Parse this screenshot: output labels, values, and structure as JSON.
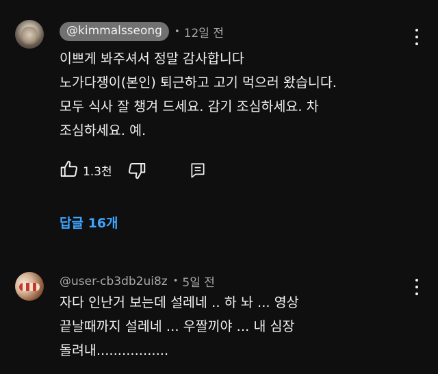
{
  "comments": [
    {
      "author": "@kimmalsseong",
      "separator": "•",
      "time": "12일 전",
      "lines": [
        "이쁘게 봐주셔서 정말 감사합니다",
        "노가다쟁이(본인) 퇴근하고 고기 먹으러 왔습니다.",
        "모두 식사 잘 챙겨 드세요. 감기 조심하세요. 차",
        "조심하세요. 예."
      ],
      "like_count": "1.3천",
      "replies_label": "답글 16개"
    },
    {
      "author": "@user-cb3db2ui8z",
      "separator": "•",
      "time": "5일 전",
      "lines": [
        "자다 인난거 보는데 설레네 .. 하 놔 ... 영상",
        "끝날때까지 설레네 ... 우짤끼야 ... 내 심장",
        "돌려내................."
      ]
    }
  ],
  "icons": {
    "like": "thumbs-up-icon",
    "dislike": "thumbs-down-icon",
    "reply": "reply-icon",
    "menu": "more-vert-icon"
  },
  "colors": {
    "background": "#0f0f0f",
    "text": "#f1f1f1",
    "secondary_text": "#aaaaaa",
    "chip": "#717171",
    "link": "#3ea6ff"
  }
}
